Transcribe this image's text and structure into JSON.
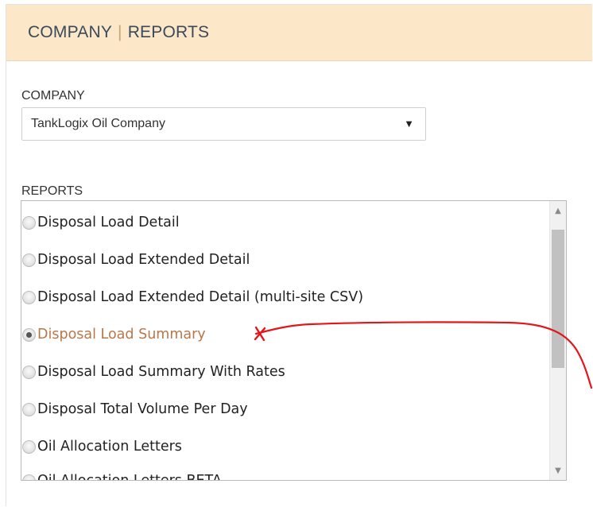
{
  "header": {
    "part1": "COMPANY",
    "separator": "|",
    "part2": "REPORTS"
  },
  "company": {
    "label": "COMPANY",
    "selected": "TankLogix Oil Company",
    "arrow_icon": "▼"
  },
  "reports": {
    "label": "REPORTS",
    "selected_index": 3,
    "items": [
      {
        "label": "Disposal Load Detail"
      },
      {
        "label": "Disposal Load Extended Detail"
      },
      {
        "label": "Disposal Load Extended Detail (multi-site CSV)"
      },
      {
        "label": "Disposal Load Summary"
      },
      {
        "label": "Disposal Load Summary With Rates"
      },
      {
        "label": "Disposal Total Volume Per Day"
      },
      {
        "label": "Oil Allocation Letters"
      },
      {
        "label": "Oil Allocation Letters BETA"
      }
    ]
  },
  "scrollbar": {
    "up_icon": "▲",
    "down_icon": "▼"
  },
  "colors": {
    "header_bg": "#fce7c8",
    "selected_text": "#b8774a",
    "annotation": "#e3161a"
  }
}
